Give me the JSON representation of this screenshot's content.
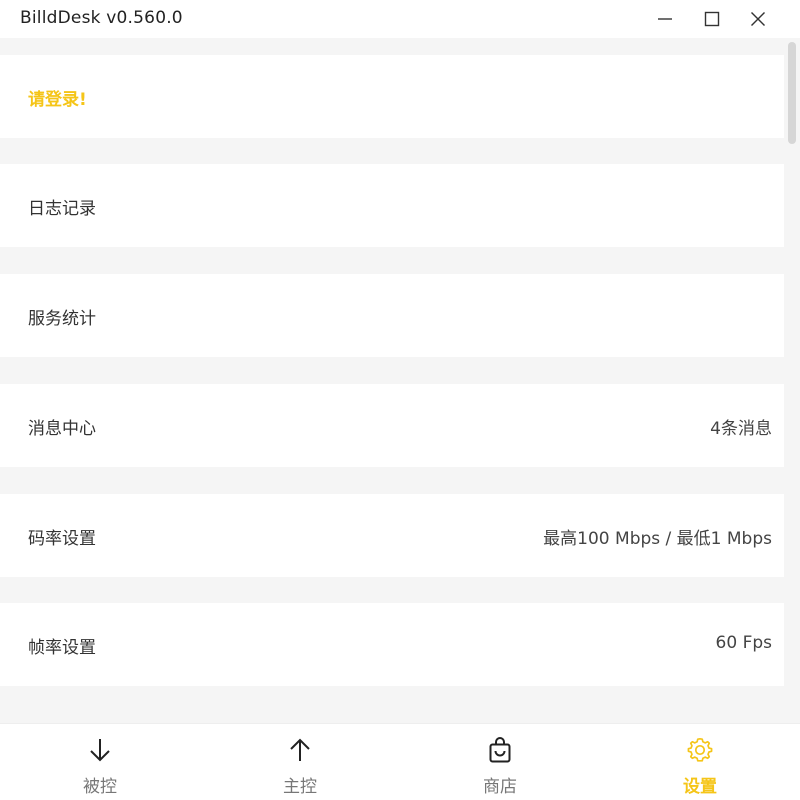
{
  "window": {
    "title": "BilldDesk v0.560.0",
    "controls": [
      "minimize-icon",
      "maximize-icon",
      "close-icon"
    ]
  },
  "login": {
    "text": "请登录!"
  },
  "settings": {
    "items": [
      {
        "label": "日志记录",
        "value": ""
      },
      {
        "label": "服务统计",
        "value": ""
      },
      {
        "label": "消息中心",
        "value": "4条消息"
      },
      {
        "label": "码率设置",
        "value": "最高100 Mbps / 最低1 Mbps"
      },
      {
        "label": "帧率设置",
        "value": "60 Fps"
      }
    ]
  },
  "nav": {
    "items": [
      {
        "label": "被控",
        "icon": "arrow-down-icon"
      },
      {
        "label": "主控",
        "icon": "arrow-up-icon"
      },
      {
        "label": "商店",
        "icon": "shopping-bag-icon"
      },
      {
        "label": "设置",
        "icon": "gear-icon"
      }
    ],
    "active_index": 3
  },
  "colors": {
    "accent": "#f5c518",
    "background": "#f5f5f5",
    "row_background": "#ffffff",
    "text": "#333333",
    "inactive_nav_text": "#777777"
  }
}
